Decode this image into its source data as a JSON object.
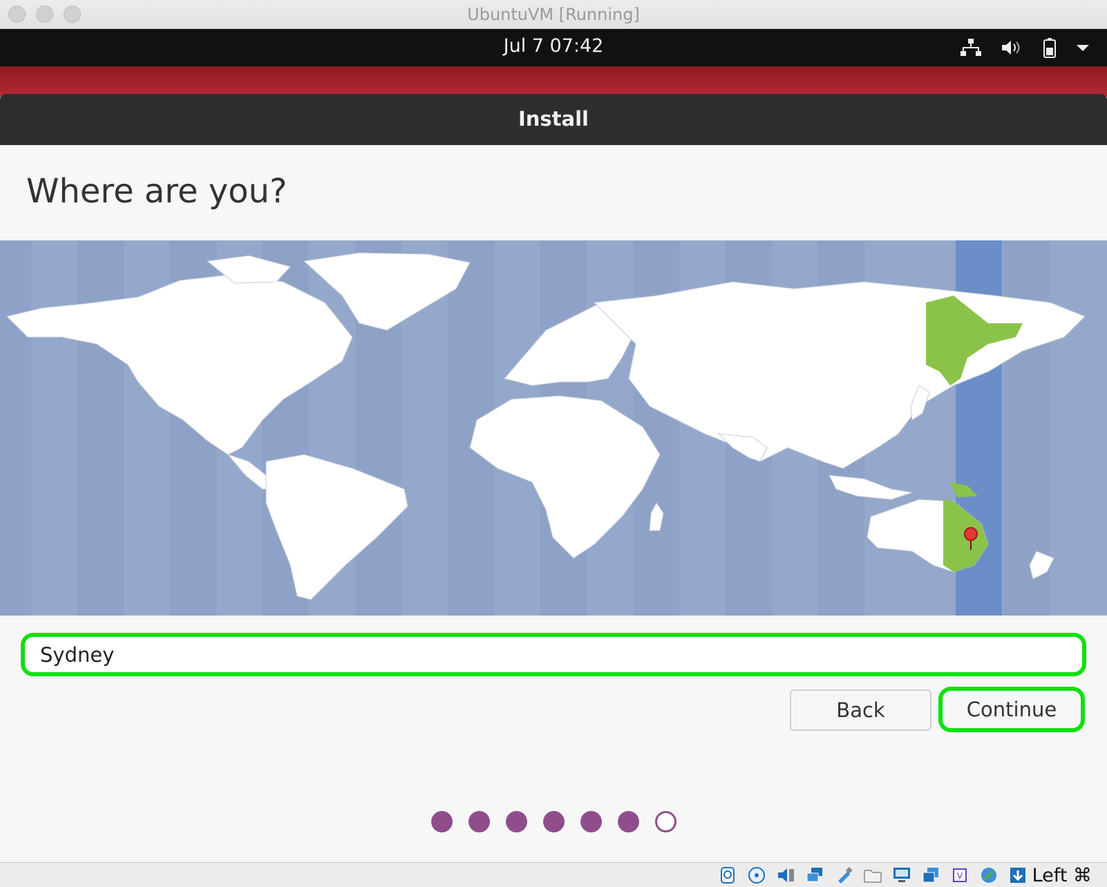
{
  "window": {
    "title": "UbuntuVM [Running]"
  },
  "top_panel": {
    "clock": "Jul 7  07:42",
    "tray_icons": [
      "network-icon",
      "volume-icon",
      "battery-icon",
      "system-menu-icon"
    ]
  },
  "dialog": {
    "header": "Install",
    "page_title": "Where are you?",
    "map": {
      "selected_city": "Sydney",
      "highlight_color": "#8bc34a"
    },
    "timezone_input_value": "Sydney",
    "back_label": "Back",
    "continue_label": "Continue",
    "progress": {
      "total_steps": 7,
      "completed_steps": 6
    }
  },
  "vbox_status": {
    "icons": [
      "hard-disk-icon",
      "optical-disk-icon",
      "audio-icon",
      "network-adapter-icon",
      "usb-icon",
      "shared-folder-icon",
      "display-icon",
      "recording-icon",
      "cpu-icon",
      "mouse-integration-icon",
      "keyboard-capture-icon"
    ],
    "host_key": "Left ⌘"
  },
  "colors": {
    "accent_purple": "#8f4d8c",
    "highlight_green": "#10e010",
    "panel_black": "#111111",
    "ubuntu_red": "#b32a33"
  }
}
